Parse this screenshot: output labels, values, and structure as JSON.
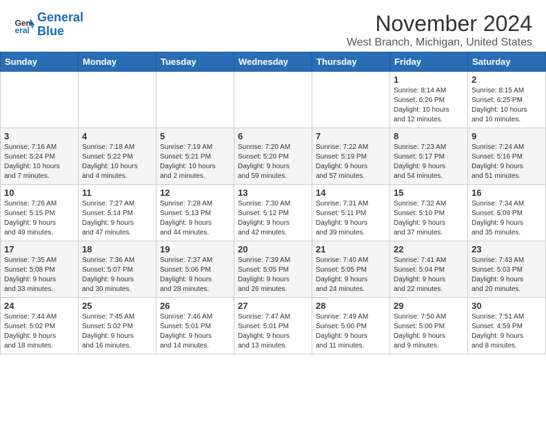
{
  "header": {
    "logo_line1": "General",
    "logo_line2": "Blue",
    "month": "November 2024",
    "location": "West Branch, Michigan, United States"
  },
  "weekdays": [
    "Sunday",
    "Monday",
    "Tuesday",
    "Wednesday",
    "Thursday",
    "Friday",
    "Saturday"
  ],
  "weeks": [
    [
      {
        "day": "",
        "info": ""
      },
      {
        "day": "",
        "info": ""
      },
      {
        "day": "",
        "info": ""
      },
      {
        "day": "",
        "info": ""
      },
      {
        "day": "",
        "info": ""
      },
      {
        "day": "1",
        "info": "Sunrise: 8:14 AM\nSunset: 6:26 PM\nDaylight: 10 hours\nand 12 minutes."
      },
      {
        "day": "2",
        "info": "Sunrise: 8:15 AM\nSunset: 6:25 PM\nDaylight: 10 hours\nand 10 minutes."
      }
    ],
    [
      {
        "day": "3",
        "info": "Sunrise: 7:16 AM\nSunset: 5:24 PM\nDaylight: 10 hours\nand 7 minutes."
      },
      {
        "day": "4",
        "info": "Sunrise: 7:18 AM\nSunset: 5:22 PM\nDaylight: 10 hours\nand 4 minutes."
      },
      {
        "day": "5",
        "info": "Sunrise: 7:19 AM\nSunset: 5:21 PM\nDaylight: 10 hours\nand 2 minutes."
      },
      {
        "day": "6",
        "info": "Sunrise: 7:20 AM\nSunset: 5:20 PM\nDaylight: 9 hours\nand 59 minutes."
      },
      {
        "day": "7",
        "info": "Sunrise: 7:22 AM\nSunset: 5:19 PM\nDaylight: 9 hours\nand 57 minutes."
      },
      {
        "day": "8",
        "info": "Sunrise: 7:23 AM\nSunset: 5:17 PM\nDaylight: 9 hours\nand 54 minutes."
      },
      {
        "day": "9",
        "info": "Sunrise: 7:24 AM\nSunset: 5:16 PM\nDaylight: 9 hours\nand 51 minutes."
      }
    ],
    [
      {
        "day": "10",
        "info": "Sunrise: 7:26 AM\nSunset: 5:15 PM\nDaylight: 9 hours\nand 49 minutes."
      },
      {
        "day": "11",
        "info": "Sunrise: 7:27 AM\nSunset: 5:14 PM\nDaylight: 9 hours\nand 47 minutes."
      },
      {
        "day": "12",
        "info": "Sunrise: 7:28 AM\nSunset: 5:13 PM\nDaylight: 9 hours\nand 44 minutes."
      },
      {
        "day": "13",
        "info": "Sunrise: 7:30 AM\nSunset: 5:12 PM\nDaylight: 9 hours\nand 42 minutes."
      },
      {
        "day": "14",
        "info": "Sunrise: 7:31 AM\nSunset: 5:11 PM\nDaylight: 9 hours\nand 39 minutes."
      },
      {
        "day": "15",
        "info": "Sunrise: 7:32 AM\nSunset: 5:10 PM\nDaylight: 9 hours\nand 37 minutes."
      },
      {
        "day": "16",
        "info": "Sunrise: 7:34 AM\nSunset: 5:09 PM\nDaylight: 9 hours\nand 35 minutes."
      }
    ],
    [
      {
        "day": "17",
        "info": "Sunrise: 7:35 AM\nSunset: 5:08 PM\nDaylight: 9 hours\nand 33 minutes."
      },
      {
        "day": "18",
        "info": "Sunrise: 7:36 AM\nSunset: 5:07 PM\nDaylight: 9 hours\nand 30 minutes."
      },
      {
        "day": "19",
        "info": "Sunrise: 7:37 AM\nSunset: 5:06 PM\nDaylight: 9 hours\nand 28 minutes."
      },
      {
        "day": "20",
        "info": "Sunrise: 7:39 AM\nSunset: 5:05 PM\nDaylight: 9 hours\nand 26 minutes."
      },
      {
        "day": "21",
        "info": "Sunrise: 7:40 AM\nSunset: 5:05 PM\nDaylight: 9 hours\nand 24 minutes."
      },
      {
        "day": "22",
        "info": "Sunrise: 7:41 AM\nSunset: 5:04 PM\nDaylight: 9 hours\nand 22 minutes."
      },
      {
        "day": "23",
        "info": "Sunrise: 7:43 AM\nSunset: 5:03 PM\nDaylight: 9 hours\nand 20 minutes."
      }
    ],
    [
      {
        "day": "24",
        "info": "Sunrise: 7:44 AM\nSunset: 5:02 PM\nDaylight: 9 hours\nand 18 minutes."
      },
      {
        "day": "25",
        "info": "Sunrise: 7:45 AM\nSunset: 5:02 PM\nDaylight: 9 hours\nand 16 minutes."
      },
      {
        "day": "26",
        "info": "Sunrise: 7:46 AM\nSunset: 5:01 PM\nDaylight: 9 hours\nand 14 minutes."
      },
      {
        "day": "27",
        "info": "Sunrise: 7:47 AM\nSunset: 5:01 PM\nDaylight: 9 hours\nand 13 minutes."
      },
      {
        "day": "28",
        "info": "Sunrise: 7:49 AM\nSunset: 5:00 PM\nDaylight: 9 hours\nand 11 minutes."
      },
      {
        "day": "29",
        "info": "Sunrise: 7:50 AM\nSunset: 5:00 PM\nDaylight: 9 hours\nand 9 minutes."
      },
      {
        "day": "30",
        "info": "Sunrise: 7:51 AM\nSunset: 4:59 PM\nDaylight: 9 hours\nand 8 minutes."
      }
    ]
  ]
}
